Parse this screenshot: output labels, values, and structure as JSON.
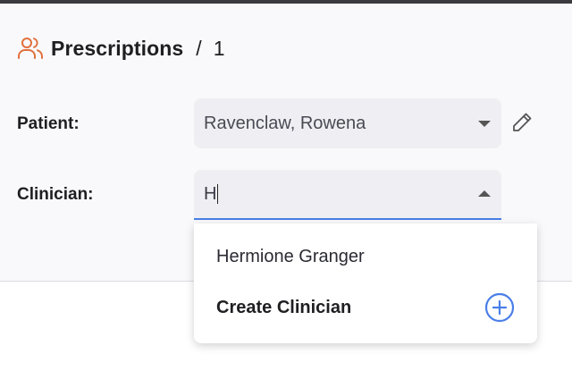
{
  "header": {
    "icon": "people-icon",
    "title": "Prescriptions",
    "separator": "/",
    "record_number": "1",
    "icon_color": "#e0703d"
  },
  "fields": {
    "patient": {
      "label": "Patient:",
      "value": "Ravenclaw, Rowena"
    },
    "clinician": {
      "label": "Clinician:",
      "value": "H"
    }
  },
  "dropdown": {
    "options": [
      {
        "label": "Hermione Granger"
      },
      {
        "label": "Create Clinician",
        "icon": "plus-circle-icon"
      }
    ]
  },
  "colors": {
    "accent": "#4a7ee8",
    "field_background": "#efeff3"
  }
}
